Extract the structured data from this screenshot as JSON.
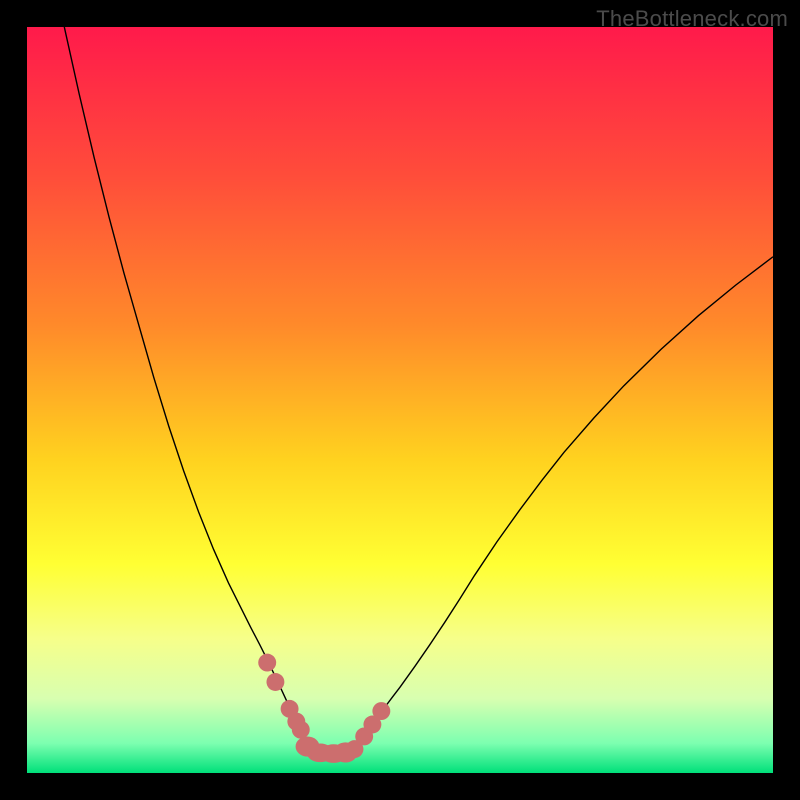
{
  "watermark": "TheBottleneck.com",
  "chart_data": {
    "type": "line",
    "title": "",
    "xlabel": "",
    "ylabel": "",
    "xlim": [
      0,
      100
    ],
    "ylim": [
      0,
      100
    ],
    "gradient_stops": [
      {
        "offset": 0.0,
        "color": "#ff1a4b"
      },
      {
        "offset": 0.2,
        "color": "#ff4d3a"
      },
      {
        "offset": 0.4,
        "color": "#ff8a2a"
      },
      {
        "offset": 0.58,
        "color": "#ffd21f"
      },
      {
        "offset": 0.72,
        "color": "#ffff33"
      },
      {
        "offset": 0.82,
        "color": "#f6ff8a"
      },
      {
        "offset": 0.9,
        "color": "#d8ffb0"
      },
      {
        "offset": 0.96,
        "color": "#7dffb0"
      },
      {
        "offset": 1.0,
        "color": "#00e07a"
      }
    ],
    "series": [
      {
        "name": "curve",
        "stroke": "#000000",
        "x": [
          5,
          7,
          9,
          11,
          13,
          15,
          17,
          19,
          21,
          23,
          25,
          27,
          28.5,
          30,
          31.2,
          32.3,
          33.2,
          34,
          34.7,
          35.3,
          35.85,
          36.35,
          36.8,
          37.2,
          37.55,
          37.85,
          38.1,
          38.3,
          38.45,
          38.55,
          38.6,
          39.3,
          40.3,
          41.4,
          42.6,
          43.3,
          43.8,
          44.2,
          44.6,
          45,
          45.5,
          46,
          46.6,
          47.3,
          48.1,
          49,
          50,
          52,
          54,
          56,
          58,
          60,
          63,
          66,
          69,
          72,
          76,
          80,
          85,
          90,
          95,
          100
        ],
        "y": [
          100,
          91,
          82.5,
          74.5,
          67,
          60,
          53,
          46.5,
          40.5,
          35,
          30,
          25.5,
          22.5,
          19.5,
          17.2,
          15,
          13.1,
          11.4,
          9.9,
          8.6,
          7.4,
          6.4,
          5.6,
          4.9,
          4.3,
          3.8,
          3.4,
          3.1,
          2.9,
          2.75,
          2.7,
          2.63,
          2.6,
          2.6,
          2.63,
          2.75,
          3.0,
          3.4,
          3.9,
          4.5,
          5.2,
          6.0,
          6.9,
          7.9,
          9.0,
          10.2,
          11.5,
          14.3,
          17.2,
          20.2,
          23.3,
          26.5,
          31.0,
          35.2,
          39.2,
          43.0,
          47.6,
          51.9,
          56.8,
          61.3,
          65.4,
          69.2
        ]
      }
    ],
    "markers": {
      "name": "dots",
      "fill": "#cc6e6e",
      "stroke": "#cc6e6e",
      "r": 1.2,
      "points": [
        {
          "x": 32.2,
          "y": 14.8
        },
        {
          "x": 33.3,
          "y": 12.2
        },
        {
          "x": 35.2,
          "y": 8.6
        },
        {
          "x": 36.1,
          "y": 6.9
        },
        {
          "x": 36.7,
          "y": 5.8
        },
        {
          "x": 43.9,
          "y": 3.2
        },
        {
          "x": 45.2,
          "y": 4.9
        },
        {
          "x": 46.3,
          "y": 6.5
        },
        {
          "x": 47.5,
          "y": 8.3
        }
      ]
    },
    "bottom_blobs": {
      "name": "blobs",
      "fill": "#cc6e6e",
      "points": [
        {
          "x": 37.6,
          "y": 3.55,
          "rx": 1.6,
          "ry": 1.35
        },
        {
          "x": 39.3,
          "y": 2.7,
          "rx": 1.8,
          "ry": 1.25
        },
        {
          "x": 41.1,
          "y": 2.6,
          "rx": 1.8,
          "ry": 1.25
        },
        {
          "x": 42.7,
          "y": 2.75,
          "rx": 1.6,
          "ry": 1.35
        }
      ]
    }
  }
}
